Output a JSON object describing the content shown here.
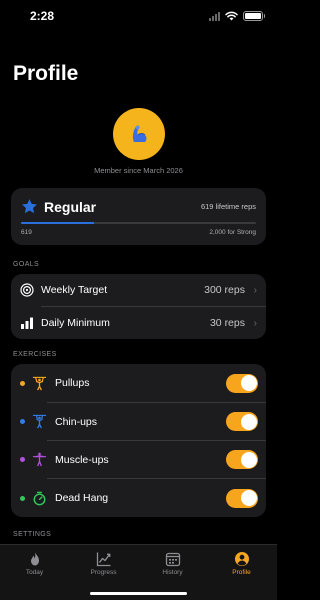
{
  "status_bar": {
    "time": "2:28"
  },
  "header": {
    "title": "Profile"
  },
  "profile": {
    "member_since": "Member since March 2026",
    "avatar_icon": "flexed-biceps-icon",
    "accent": "#f5b41c"
  },
  "rank": {
    "name": "Regular",
    "lifetime": "619 lifetime reps",
    "current": "619",
    "next_label": "2,000 for Strong",
    "progress_fraction": 0.31,
    "star_color": "#2a6fdc"
  },
  "goals": {
    "header": "GOALS",
    "items": [
      {
        "label": "Weekly Target",
        "value": "300 reps",
        "icon": "target-icon"
      },
      {
        "label": "Daily Minimum",
        "value": "30 reps",
        "icon": "bar-chart-icon"
      }
    ]
  },
  "exercises": {
    "header": "EXERCISES",
    "items": [
      {
        "label": "Pullups",
        "dot_color": "#f5a623",
        "icon": "pullup-figure-icon",
        "enabled": true
      },
      {
        "label": "Chin-ups",
        "dot_color": "#2f7fe8",
        "icon": "chinup-figure-icon",
        "enabled": true
      },
      {
        "label": "Muscle-ups",
        "dot_color": "#b450e0",
        "icon": "muscleup-figure-icon",
        "enabled": true
      },
      {
        "label": "Dead Hang",
        "dot_color": "#34c759",
        "icon": "timer-icon",
        "enabled": true
      }
    ]
  },
  "settings": {
    "header": "SETTINGS"
  },
  "tabbar": {
    "tabs": [
      {
        "label": "Today",
        "icon": "flame-icon"
      },
      {
        "label": "Progress",
        "icon": "chart-line-icon"
      },
      {
        "label": "History",
        "icon": "calendar-icon"
      },
      {
        "label": "Profile",
        "icon": "person-circle-icon",
        "active": true
      }
    ],
    "active_color": "#f5a623"
  }
}
